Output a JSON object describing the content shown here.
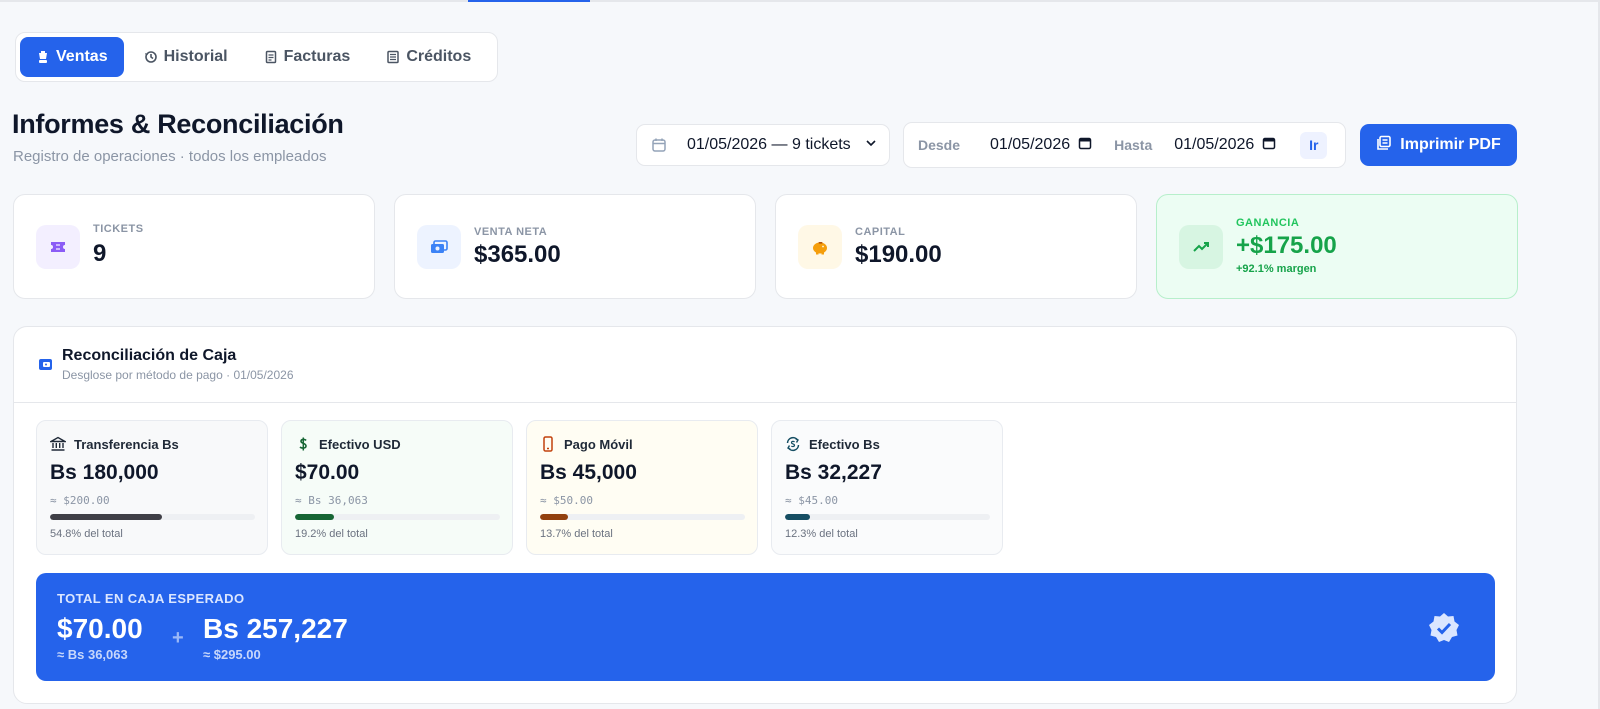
{
  "tabs": [
    {
      "label": "Ventas",
      "icon": "cart-icon",
      "active": true
    },
    {
      "label": "Historial",
      "icon": "history-icon",
      "active": false
    },
    {
      "label": "Facturas",
      "icon": "invoice-icon",
      "active": false
    },
    {
      "label": "Créditos",
      "icon": "credits-icon",
      "active": false
    }
  ],
  "header": {
    "title": "Informes & Reconciliación",
    "subtitle": "Registro de operaciones · todos los empleados"
  },
  "filters": {
    "ticket_select": "01/05/2026 — 9 tickets",
    "desde_label": "Desde",
    "desde_value": "01/05/2026",
    "hasta_label": "Hasta",
    "hasta_value": "01/05/2026",
    "go_label": "Ir",
    "print_label": "Imprimir PDF"
  },
  "stats": [
    {
      "label": "TICKETS",
      "value": "9",
      "icon": "ticket-icon",
      "color": "#8b5cf6"
    },
    {
      "label": "VENTA NETA",
      "value": "$365.00",
      "icon": "cash-icon",
      "color": "#3b82f6"
    },
    {
      "label": "CAPITAL",
      "value": "$190.00",
      "icon": "piggy-bank-icon",
      "color": "#f59e0b"
    },
    {
      "label": "GANANCIA",
      "value": "+$175.00",
      "sub": "+92.1% margen",
      "icon": "trend-up-icon",
      "color": "#16a34a"
    }
  ],
  "reconciliation": {
    "title": "Reconciliación de Caja",
    "subtitle": "Desglose por método de pago · 01/05/2026",
    "methods": [
      {
        "name": "Transferencia Bs",
        "amount": "Bs 180,000",
        "approx": "≈ $200.00",
        "pct_label": "54.8% del total",
        "pct": 54.8,
        "color": "#3f3f46",
        "bg": "#f8f9fa",
        "icon": "bank-icon"
      },
      {
        "name": "Efectivo USD",
        "amount": "$70.00",
        "approx": "≈ Bs 36,063",
        "pct_label": "19.2% del total",
        "pct": 19.2,
        "color": "#166534",
        "bg": "#f6fcf8",
        "icon": "dollar-icon"
      },
      {
        "name": "Pago Móvil",
        "amount": "Bs 45,000",
        "approx": "≈ $50.00",
        "pct_label": "13.7% del total",
        "pct": 13.7,
        "color": "#92400e",
        "bg": "#fffdf3",
        "icon": "mobile-phone-icon"
      },
      {
        "name": "Efectivo Bs",
        "amount": "Bs 32,227",
        "approx": "≈ $45.00",
        "pct_label": "12.3% del total",
        "pct": 12.3,
        "color": "#164e63",
        "bg": "#fafbfc",
        "icon": "exchange-icon"
      }
    ],
    "total": {
      "label": "TOTAL EN CAJA ESPERADO",
      "usd": "$70.00",
      "usd_sub": "≈ Bs 36,063",
      "plus": "+",
      "bs": "Bs 257,227",
      "bs_sub": "≈ $295.00"
    }
  }
}
